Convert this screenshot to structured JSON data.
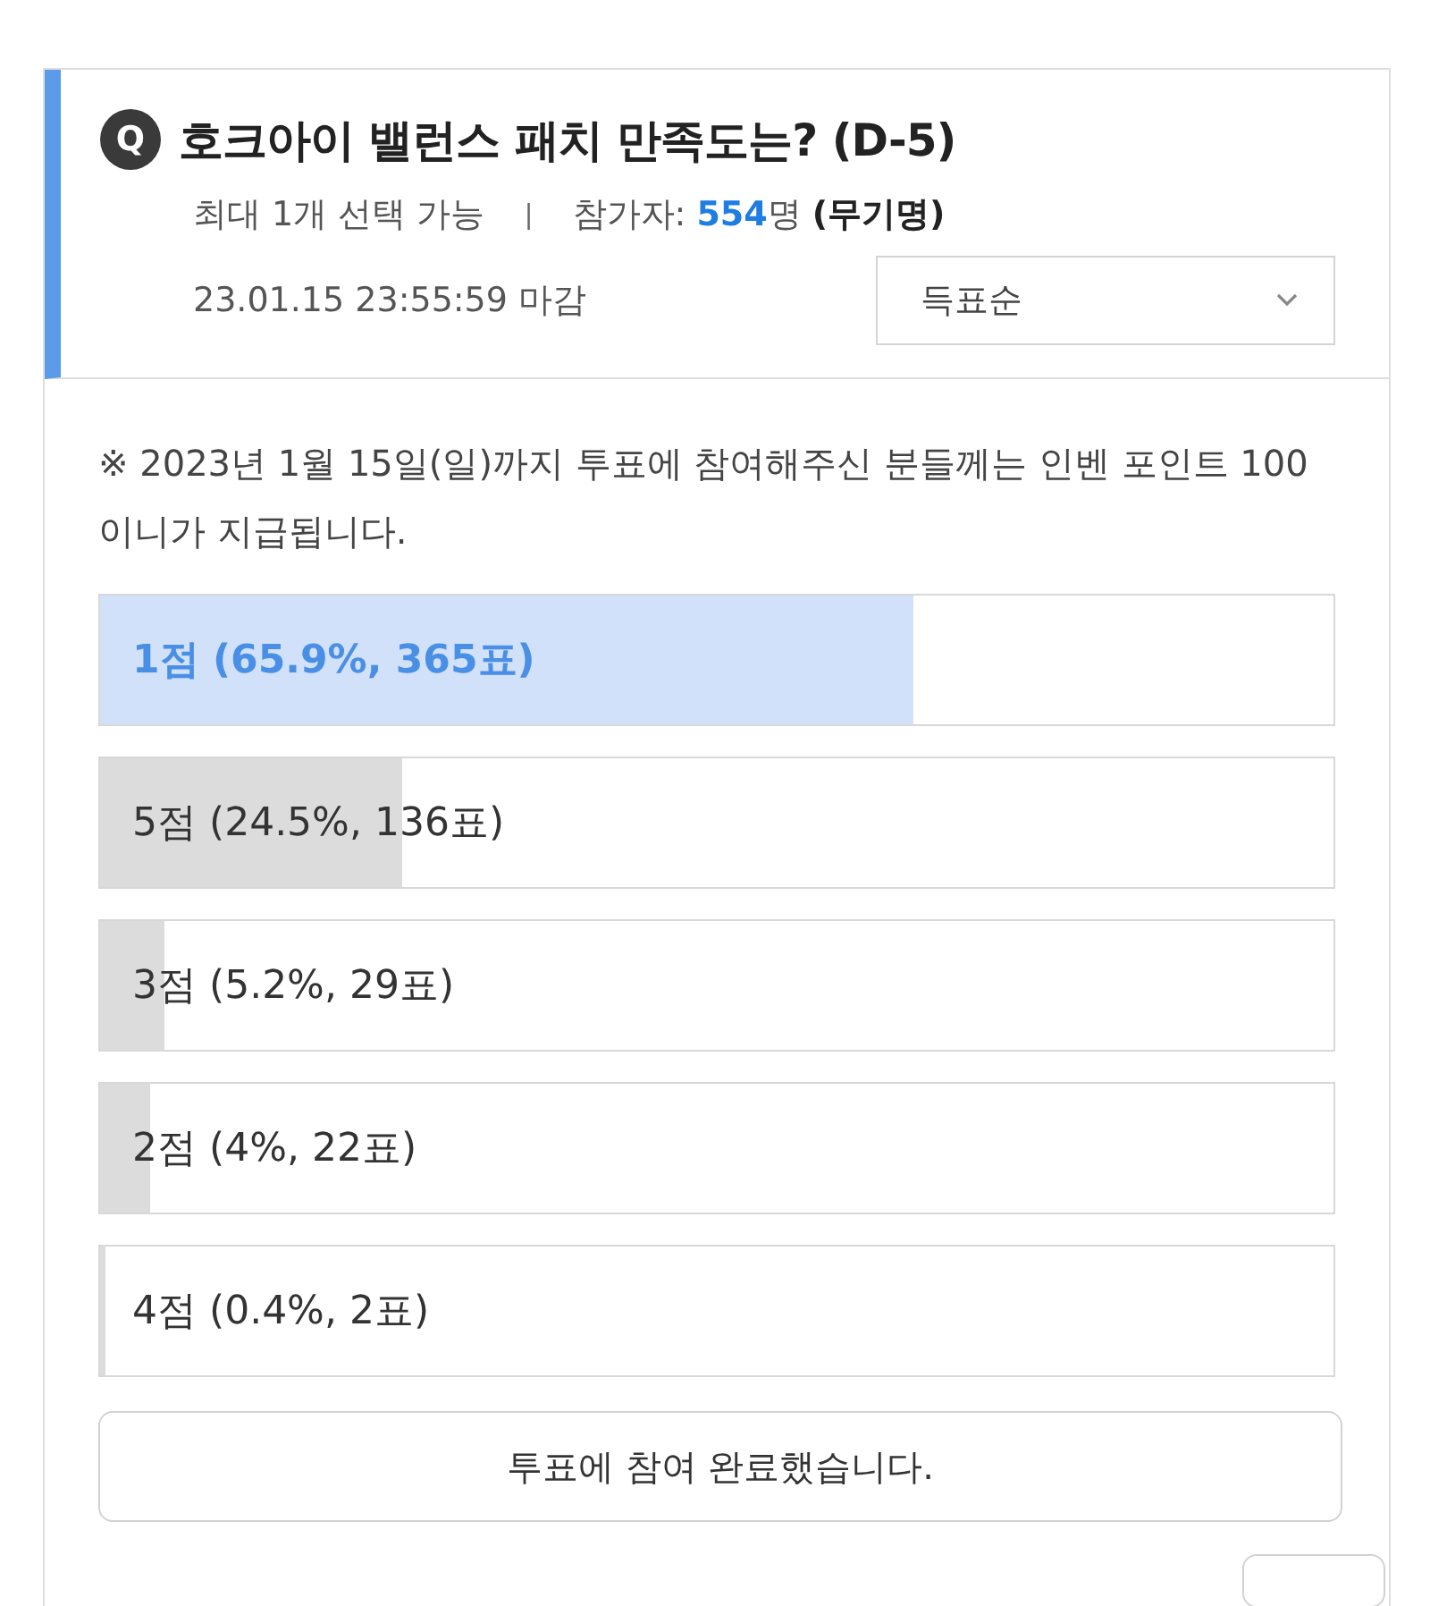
{
  "poll": {
    "badge": "Q",
    "title": "호크아이 밸런스 패치 만족도는? (D-5)",
    "limit": "최대 1개 선택 가능",
    "separator": "|",
    "participants_label": "참가자:",
    "participants_count": "554",
    "participants_unit": "명",
    "anonymous": "(무기명)",
    "deadline": "23.01.15 23:55:59 마감",
    "sort": {
      "value": "득표순"
    },
    "notice": "※ 2023년 1월 15일(일)까지 투표에 참여해주신 분들께는 인벤 포인트 100이니가 지급됩니다.",
    "options": [
      {
        "label": "1점 (65.9%, 365표)",
        "level": 0.659,
        "selected": true
      },
      {
        "label": "5점 (24.5%, 136표)",
        "level": 0.245,
        "selected": false
      },
      {
        "label": "3점 (5.2%, 29표)",
        "level": 0.052,
        "selected": false
      },
      {
        "label": "2점 (4%, 22표)",
        "level": 0.04,
        "selected": false
      },
      {
        "label": "4점 (0.4%, 2표)",
        "level": 0.004,
        "selected": false
      }
    ],
    "submit_button": "투표에 참여 완료했습니다."
  }
}
